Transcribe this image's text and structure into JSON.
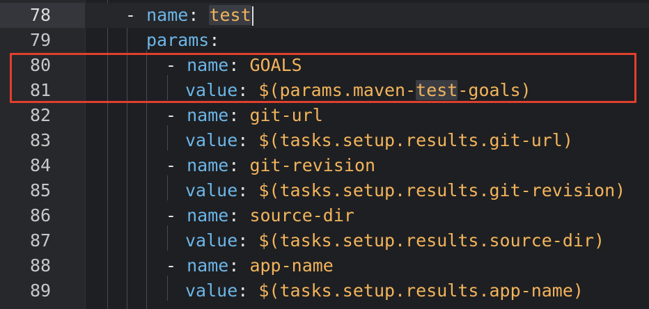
{
  "editor": {
    "lines": [
      {
        "num": "78",
        "dash": "- ",
        "key": "name",
        "colon": ": ",
        "val": "test",
        "current": true
      },
      {
        "num": "79",
        "dash": "",
        "key": "params",
        "colon": ":",
        "val": ""
      },
      {
        "num": "80",
        "dash": "- ",
        "key": "name",
        "colon": ": ",
        "val": "GOALS"
      },
      {
        "num": "81",
        "dash": "",
        "key": "value",
        "colon": ": ",
        "val_pre": "$(params.maven-",
        "val_match": "test",
        "val_post": "-goals)"
      },
      {
        "num": "82",
        "dash": "- ",
        "key": "name",
        "colon": ": ",
        "val": "git-url"
      },
      {
        "num": "83",
        "dash": "",
        "key": "value",
        "colon": ": ",
        "val": "$(tasks.setup.results.git-url)"
      },
      {
        "num": "84",
        "dash": "- ",
        "key": "name",
        "colon": ": ",
        "val": "git-revision"
      },
      {
        "num": "85",
        "dash": "",
        "key": "value",
        "colon": ": ",
        "val": "$(tasks.setup.results.git-revision)"
      },
      {
        "num": "86",
        "dash": "- ",
        "key": "name",
        "colon": ": ",
        "val": "source-dir"
      },
      {
        "num": "87",
        "dash": "",
        "key": "value",
        "colon": ": ",
        "val": "$(tasks.setup.results.source-dir)"
      },
      {
        "num": "88",
        "dash": "- ",
        "key": "name",
        "colon": ": ",
        "val": "app-name"
      },
      {
        "num": "89",
        "dash": "",
        "key": "value",
        "colon": ": ",
        "val": "$(tasks.setup.results.app-name)"
      }
    ]
  },
  "colors": {
    "background": "#1e1f22",
    "gutter": "#27282c",
    "key": "#6cb6e8",
    "value": "#f2b45c",
    "highlight_box": "#e0402e"
  }
}
